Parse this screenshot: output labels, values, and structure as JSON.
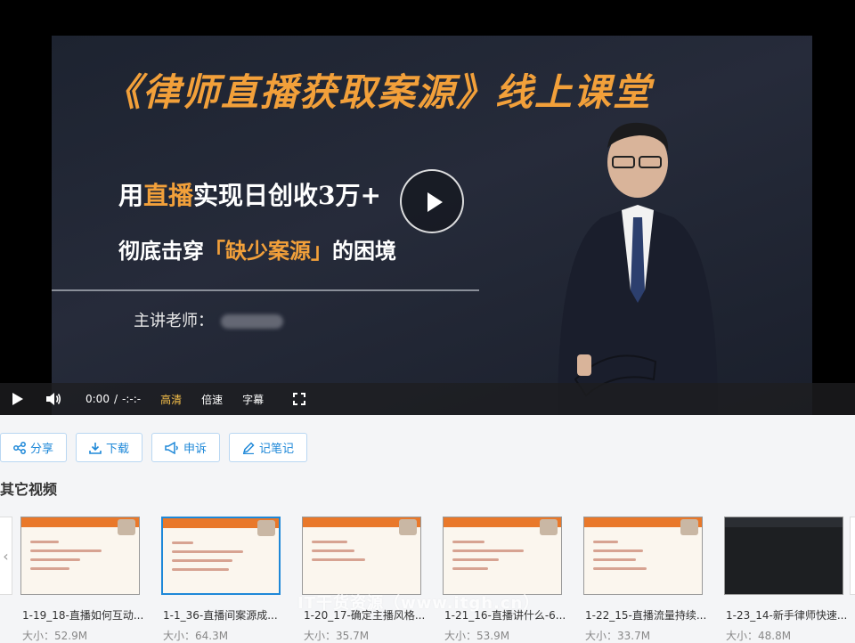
{
  "poster": {
    "title": "《律师直播获取案源》线上课堂",
    "line1_pre": "用",
    "line1_hl": "直播",
    "line1_post": "实现日创收3万+",
    "line2_pre": "彻底击穿",
    "line2_hl": "「缺少案源」",
    "line2_post": "的困境",
    "teacher_label": "主讲老师："
  },
  "controls": {
    "current_time": "0:00",
    "separator": "/",
    "duration": "-:-:-",
    "quality": "高清",
    "speed": "倍速",
    "subtitles": "字幕"
  },
  "actions": {
    "share": "分享",
    "download": "下载",
    "report": "申诉",
    "notes": "记笔记"
  },
  "section_title": "其它视频",
  "videos": [
    {
      "title": "1-19_18-直播如何互动...",
      "size": "大小：52.9M"
    },
    {
      "title": "1-1_36-直播间案源成...",
      "size": "大小：64.3M"
    },
    {
      "title": "1-20_17-确定主播风格...",
      "size": "大小：35.7M"
    },
    {
      "title": "1-21_16-直播讲什么-6...",
      "size": "大小：53.9M"
    },
    {
      "title": "1-22_15-直播流量持续...",
      "size": "大小：33.7M"
    },
    {
      "title": "1-23_14-新手律师快速...",
      "size": "大小：48.8M"
    }
  ],
  "watermark": "IT干货资源（www.itgh.cn）",
  "colors": {
    "accent": "#1e88d8",
    "poster_highlight": "#f2a03a",
    "quality_active": "#f7c04a"
  }
}
